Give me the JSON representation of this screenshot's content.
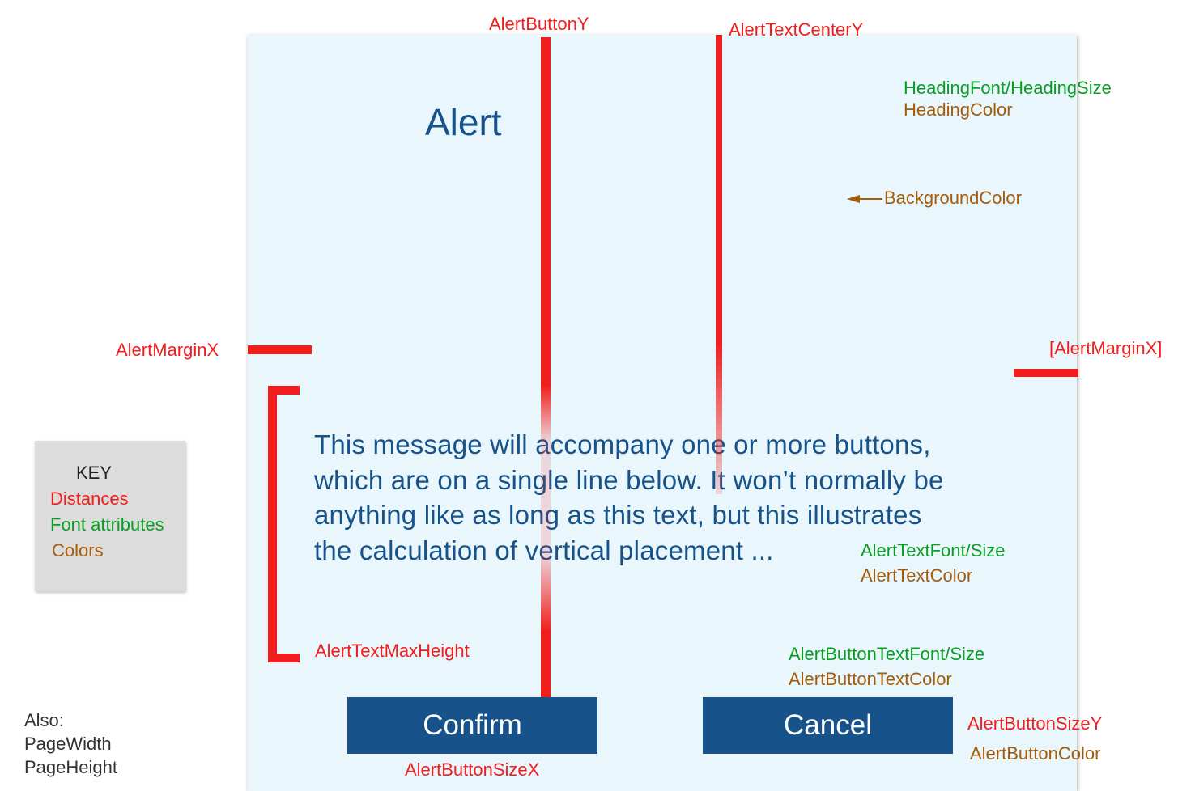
{
  "alert": {
    "heading": "Alert",
    "message_lines": [
      "This message will accompany one or more buttons,",
      "which are on a single line below. It won’t normally be",
      "anything like as long as this text, but this illustrates",
      "the calculation of vertical placement ..."
    ],
    "buttons": {
      "confirm": "Confirm",
      "cancel": "Cancel"
    }
  },
  "annotations": {
    "alert_button_y": "AlertButtonY",
    "alert_text_center_y": "AlertTextCenterY",
    "heading_font": "HeadingFont/HeadingSize",
    "heading_color": "HeadingColor",
    "background_color": "BackgroundColor",
    "alert_margin_x_left": "AlertMarginX",
    "alert_margin_x_right": "[AlertMarginX]",
    "alert_text_font": "AlertTextFont/Size",
    "alert_text_color": "AlertTextColor",
    "alert_text_max_height": "AlertTextMaxHeight",
    "alert_button_text_font": "AlertButtonTextFont/Size",
    "alert_button_text_color": "AlertButtonTextColor",
    "alert_button_size_y": "AlertButtonSizeY",
    "alert_button_color": "AlertButtonColor",
    "alert_button_size_x": "AlertButtonSizeX"
  },
  "key": {
    "title": "KEY",
    "distances": "Distances",
    "font_attributes": "Font attributes",
    "colors": "Colors"
  },
  "also": {
    "label": "Also:",
    "items": [
      "PageWidth",
      "PageHeight"
    ]
  },
  "colors": {
    "background": "#e9f7fc",
    "heading": "#17538a",
    "button": "#17538a",
    "button_text": "#ffffff",
    "distance": "#f21d1d",
    "font_attribute": "#0c9c25",
    "color_attribute": "#a45c0b"
  }
}
